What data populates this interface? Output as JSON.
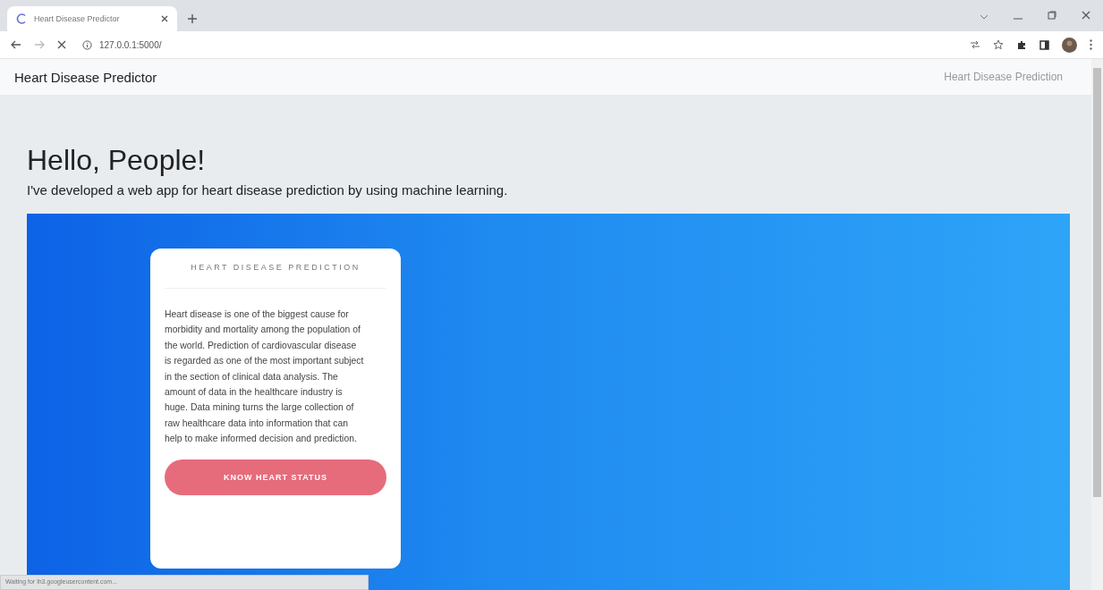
{
  "browser": {
    "tab": {
      "title": "Heart Disease Predictor",
      "loading": true
    },
    "address": "127.0.0.1:5000/",
    "status": "Waiting for lh3.googleusercontent.com..."
  },
  "navbar": {
    "brand": "Heart Disease Predictor",
    "link": "Heart Disease Prediction"
  },
  "hero": {
    "heading": "Hello, People!",
    "lead": "I've developed a web app for heart disease prediction by using machine learning."
  },
  "card": {
    "title": "HEART DISEASE PREDICTION",
    "text": "Heart disease is one of the biggest cause for morbidity and mortality among the population of the world. Prediction of cardiovascular disease is regarded as one of the most important subject in the section of clinical data analysis. The amount of data in the healthcare industry is huge. Data mining turns the large collection of raw healthcare data into information that can help to make informed decision and prediction.",
    "button": "KNOW HEART STATUS"
  }
}
